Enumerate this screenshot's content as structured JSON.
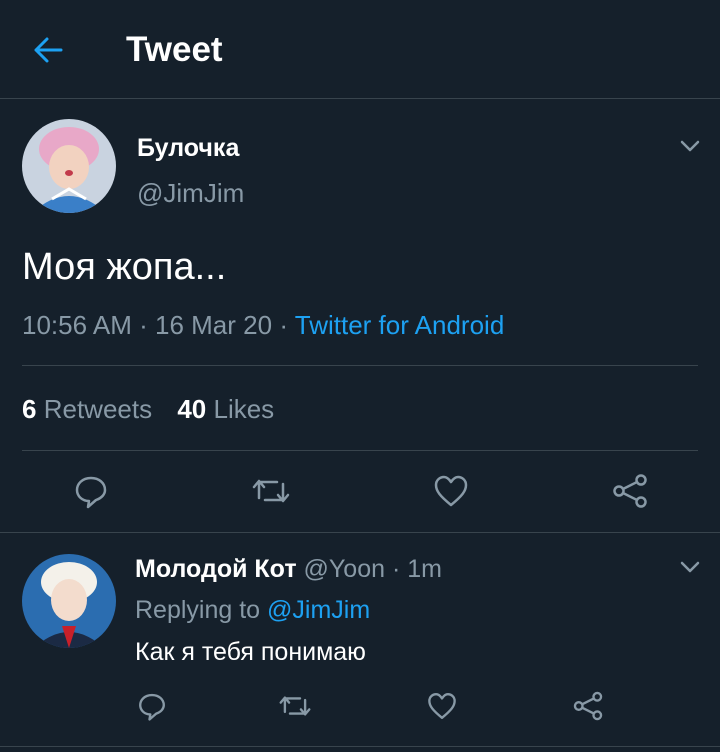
{
  "header": {
    "title": "Tweet"
  },
  "tweet": {
    "author_name": "Булочка",
    "author_handle": "@JimJim",
    "text": "Моя жопа...",
    "time": "10:56 AM",
    "date": "16 Mar 20",
    "source": "Twitter for Android",
    "retweets_count": "6",
    "retweets_label": "Retweets",
    "likes_count": "40",
    "likes_label": "Likes"
  },
  "reply": {
    "author_name": "Молодой Кот",
    "author_handle": "@Yoon",
    "age": "1m",
    "replying_prefix": "Replying to",
    "replying_to": "@JimJim",
    "text": "Как я тебя понимаю"
  },
  "separator": "·",
  "icons": {
    "back": "arrow-left-icon",
    "menu": "chevron-down-icon",
    "reply": "comment-icon",
    "retweet": "retweet-icon",
    "like": "heart-icon",
    "share": "share-icon"
  },
  "colors": {
    "background": "#15202b",
    "accent": "#1da1f2",
    "muted": "#8899a6",
    "divider": "#38444d"
  }
}
